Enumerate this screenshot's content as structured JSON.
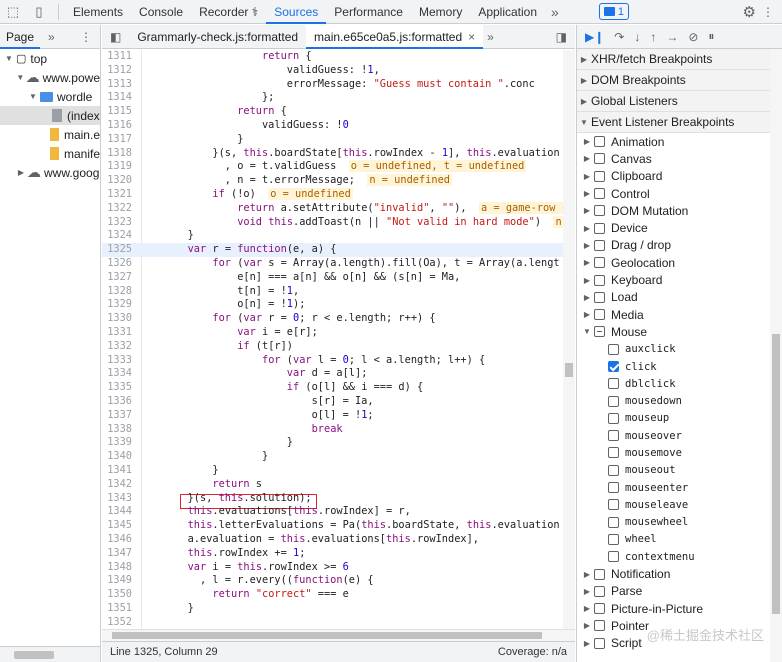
{
  "toolbar": {
    "tabs": [
      "Elements",
      "Console",
      "Recorder ⚕",
      "Sources",
      "Performance",
      "Memory",
      "Application"
    ],
    "active_tab": "Sources",
    "more": "»",
    "badge_count": "1"
  },
  "navigator": {
    "tab": "Page",
    "more": "»",
    "menu": "⋮",
    "tree": [
      {
        "indent": 0,
        "tri": "▼",
        "icon": "frame",
        "label": "top"
      },
      {
        "indent": 1,
        "tri": "▼",
        "icon": "cloud",
        "label": "www.powe"
      },
      {
        "indent": 2,
        "tri": "▼",
        "icon": "folder",
        "label": "wordle"
      },
      {
        "indent": 3,
        "tri": "",
        "icon": "file-gray",
        "label": "(index",
        "selected": true
      },
      {
        "indent": 3,
        "tri": "",
        "icon": "file",
        "label": "main.e"
      },
      {
        "indent": 3,
        "tri": "",
        "icon": "file",
        "label": "manife"
      },
      {
        "indent": 1,
        "tri": "▶",
        "icon": "cloud",
        "label": "www.goog"
      }
    ]
  },
  "editor": {
    "tabs": [
      {
        "label": "Grammarly-check.js:formatted",
        "active": false
      },
      {
        "label": "main.e65ce0a5.js:formatted",
        "active": true
      }
    ],
    "more": "»",
    "highlight_line": 1325,
    "lines": [
      {
        "n": "1311",
        "parts": [
          [
            "ct",
            "                    "
          ],
          [
            "kw",
            "return"
          ],
          [
            "ct",
            " {"
          ]
        ]
      },
      {
        "n": "1312",
        "parts": [
          [
            "ct",
            "                        validGuess: !"
          ],
          [
            "nm",
            "1"
          ],
          [
            "ct",
            ","
          ]
        ]
      },
      {
        "n": "1313",
        "parts": [
          [
            "ct",
            "                        errorMessage: "
          ],
          [
            "st",
            "\"Guess must contain \""
          ],
          [
            "ct",
            ".conc"
          ]
        ]
      },
      {
        "n": "1314",
        "parts": [
          [
            "ct",
            "                    };"
          ]
        ]
      },
      {
        "n": "1315",
        "parts": [
          [
            "ct",
            "                "
          ],
          [
            "kw",
            "return"
          ],
          [
            "ct",
            " {"
          ]
        ]
      },
      {
        "n": "1316",
        "parts": [
          [
            "ct",
            "                    validGuess: !"
          ],
          [
            "nm",
            "0"
          ]
        ]
      },
      {
        "n": "1317",
        "parts": [
          [
            "ct",
            "                }"
          ]
        ]
      },
      {
        "n": "1318",
        "parts": [
          [
            "ct",
            "            }(s, "
          ],
          [
            "kw",
            "this"
          ],
          [
            "ct",
            ".boardState["
          ],
          [
            "kw",
            "this"
          ],
          [
            "ct",
            ".rowIndex - "
          ],
          [
            "nm",
            "1"
          ],
          [
            "ct",
            "], "
          ],
          [
            "kw",
            "this"
          ],
          [
            "ct",
            ".evaluation"
          ]
        ]
      },
      {
        "n": "1319",
        "parts": [
          [
            "ct",
            "              , o = t.validGuess  "
          ],
          [
            "iv",
            "o = undefined, t = undefined"
          ]
        ]
      },
      {
        "n": "1320",
        "parts": [
          [
            "ct",
            "              , n = t.errorMessage;  "
          ],
          [
            "iv",
            "n = undefined"
          ]
        ]
      },
      {
        "n": "1321",
        "parts": [
          [
            "ct",
            "            "
          ],
          [
            "kw",
            "if"
          ],
          [
            "ct",
            " (!o)  "
          ],
          [
            "iv",
            "o = undefined"
          ]
        ]
      },
      {
        "n": "1322",
        "parts": [
          [
            "ct",
            "                "
          ],
          [
            "kw",
            "return"
          ],
          [
            "ct",
            " a.setAttribute("
          ],
          [
            "st",
            "\"invalid\""
          ],
          [
            "ct",
            ", "
          ],
          [
            "st",
            "\"\""
          ],
          [
            "ct",
            "),  "
          ],
          [
            "iv",
            "a = game-row {_"
          ]
        ]
      },
      {
        "n": "1323",
        "parts": [
          [
            "ct",
            "                "
          ],
          [
            "kw",
            "void"
          ],
          [
            "ct",
            " "
          ],
          [
            "kw",
            "this"
          ],
          [
            "ct",
            ".addToast(n || "
          ],
          [
            "st",
            "\"Not valid in hard mode\""
          ],
          [
            "ct",
            ")  "
          ],
          [
            "iv",
            "n ="
          ]
        ]
      },
      {
        "n": "1324",
        "parts": [
          [
            "ct",
            "        }"
          ]
        ]
      },
      {
        "n": "1325",
        "parts": [
          [
            "ct",
            "        "
          ],
          [
            "kw",
            "var"
          ],
          [
            "ct",
            " r = "
          ],
          [
            "kw",
            "function"
          ],
          [
            "ct",
            "(e, a) {"
          ]
        ]
      },
      {
        "n": "1326",
        "parts": [
          [
            "ct",
            "            "
          ],
          [
            "kw",
            "for"
          ],
          [
            "ct",
            " ("
          ],
          [
            "kw",
            "var"
          ],
          [
            "ct",
            " s = Array(a.length).fill(Oa), t = Array(a.lengt"
          ]
        ]
      },
      {
        "n": "1327",
        "parts": [
          [
            "ct",
            "                e[n] === a[n] && o[n] && (s[n] = Ma,"
          ]
        ]
      },
      {
        "n": "1328",
        "parts": [
          [
            "ct",
            "                t[n] = !"
          ],
          [
            "nm",
            "1"
          ],
          [
            "ct",
            ","
          ]
        ]
      },
      {
        "n": "1329",
        "parts": [
          [
            "ct",
            "                o[n] = !"
          ],
          [
            "nm",
            "1"
          ],
          [
            "ct",
            ");"
          ]
        ]
      },
      {
        "n": "1330",
        "parts": [
          [
            "ct",
            "            "
          ],
          [
            "kw",
            "for"
          ],
          [
            "ct",
            " ("
          ],
          [
            "kw",
            "var"
          ],
          [
            "ct",
            " r = "
          ],
          [
            "nm",
            "0"
          ],
          [
            "ct",
            "; r < e.length; r++) {"
          ]
        ]
      },
      {
        "n": "1331",
        "parts": [
          [
            "ct",
            "                "
          ],
          [
            "kw",
            "var"
          ],
          [
            "ct",
            " i = e[r];"
          ]
        ]
      },
      {
        "n": "1332",
        "parts": [
          [
            "ct",
            "                "
          ],
          [
            "kw",
            "if"
          ],
          [
            "ct",
            " (t[r])"
          ]
        ]
      },
      {
        "n": "1333",
        "parts": [
          [
            "ct",
            "                    "
          ],
          [
            "kw",
            "for"
          ],
          [
            "ct",
            " ("
          ],
          [
            "kw",
            "var"
          ],
          [
            "ct",
            " l = "
          ],
          [
            "nm",
            "0"
          ],
          [
            "ct",
            "; l < a.length; l++) {"
          ]
        ]
      },
      {
        "n": "1334",
        "parts": [
          [
            "ct",
            "                        "
          ],
          [
            "kw",
            "var"
          ],
          [
            "ct",
            " d = a[l];"
          ]
        ]
      },
      {
        "n": "1335",
        "parts": [
          [
            "ct",
            "                        "
          ],
          [
            "kw",
            "if"
          ],
          [
            "ct",
            " (o[l] && i === d) {"
          ]
        ]
      },
      {
        "n": "1336",
        "parts": [
          [
            "ct",
            "                            s[r] = Ia,"
          ]
        ]
      },
      {
        "n": "1337",
        "parts": [
          [
            "ct",
            "                            o[l] = !"
          ],
          [
            "nm",
            "1"
          ],
          [
            "ct",
            ";"
          ]
        ]
      },
      {
        "n": "1338",
        "parts": [
          [
            "ct",
            "                            "
          ],
          [
            "kw",
            "break"
          ]
        ]
      },
      {
        "n": "1339",
        "parts": [
          [
            "ct",
            "                        }"
          ]
        ]
      },
      {
        "n": "1340",
        "parts": [
          [
            "ct",
            "                    }"
          ]
        ]
      },
      {
        "n": "1341",
        "parts": [
          [
            "ct",
            "            }"
          ]
        ]
      },
      {
        "n": "1342",
        "parts": [
          [
            "ct",
            "            "
          ],
          [
            "kw",
            "return"
          ],
          [
            "ct",
            " s"
          ]
        ]
      },
      {
        "n": "1343",
        "parts": [
          [
            "ct",
            "        }(s, "
          ],
          [
            "kw",
            "this"
          ],
          [
            "ct",
            ".solution);"
          ]
        ]
      },
      {
        "n": "1344",
        "parts": [
          [
            "ct",
            "        "
          ],
          [
            "kw",
            "this"
          ],
          [
            "ct",
            ".evaluations["
          ],
          [
            "kw",
            "this"
          ],
          [
            "ct",
            ".rowIndex] = r,"
          ]
        ]
      },
      {
        "n": "1345",
        "parts": [
          [
            "ct",
            "        "
          ],
          [
            "kw",
            "this"
          ],
          [
            "ct",
            ".letterEvaluations = Pa("
          ],
          [
            "kw",
            "this"
          ],
          [
            "ct",
            ".boardState, "
          ],
          [
            "kw",
            "this"
          ],
          [
            "ct",
            ".evaluation"
          ]
        ]
      },
      {
        "n": "1346",
        "parts": [
          [
            "ct",
            "        a.evaluation = "
          ],
          [
            "kw",
            "this"
          ],
          [
            "ct",
            ".evaluations["
          ],
          [
            "kw",
            "this"
          ],
          [
            "ct",
            ".rowIndex],"
          ]
        ]
      },
      {
        "n": "1347",
        "parts": [
          [
            "ct",
            "        "
          ],
          [
            "kw",
            "this"
          ],
          [
            "ct",
            ".rowIndex += "
          ],
          [
            "nm",
            "1"
          ],
          [
            "ct",
            ";"
          ]
        ]
      },
      {
        "n": "1348",
        "parts": [
          [
            "ct",
            "        "
          ],
          [
            "kw",
            "var"
          ],
          [
            "ct",
            " i = "
          ],
          [
            "kw",
            "this"
          ],
          [
            "ct",
            ".rowIndex >= "
          ],
          [
            "nm",
            "6"
          ]
        ]
      },
      {
        "n": "1349",
        "parts": [
          [
            "ct",
            "          , l = r.every(("
          ],
          [
            "kw",
            "function"
          ],
          [
            "ct",
            "(e) {"
          ]
        ]
      },
      {
        "n": "1350",
        "parts": [
          [
            "ct",
            "            "
          ],
          [
            "kw",
            "return"
          ],
          [
            "ct",
            " "
          ],
          [
            "st",
            "\"correct\""
          ],
          [
            "ct",
            " === e"
          ]
        ]
      },
      {
        "n": "1351",
        "parts": [
          [
            "ct",
            "        }"
          ]
        ]
      },
      {
        "n": "1352",
        "parts": [
          [
            "ct",
            ""
          ]
        ]
      }
    ],
    "status_position": "Line 1325, Column 29",
    "status_coverage": "Coverage: n/a"
  },
  "debugger": {
    "sections": [
      "XHR/fetch Breakpoints",
      "DOM Breakpoints",
      "Global Listeners",
      "Event Listener Breakpoints"
    ],
    "categories_before": [
      "Animation",
      "Canvas",
      "Clipboard",
      "Control",
      "DOM Mutation",
      "Device",
      "Drag / drop",
      "Geolocation",
      "Keyboard",
      "Load",
      "Media"
    ],
    "mouse_label": "Mouse",
    "mouse_events": [
      {
        "label": "auxclick",
        "checked": false
      },
      {
        "label": "click",
        "checked": true
      },
      {
        "label": "dblclick",
        "checked": false
      },
      {
        "label": "mousedown",
        "checked": false
      },
      {
        "label": "mouseup",
        "checked": false
      },
      {
        "label": "mouseover",
        "checked": false
      },
      {
        "label": "mousemove",
        "checked": false
      },
      {
        "label": "mouseout",
        "checked": false
      },
      {
        "label": "mouseenter",
        "checked": false
      },
      {
        "label": "mouseleave",
        "checked": false
      },
      {
        "label": "mousewheel",
        "checked": false
      },
      {
        "label": "wheel",
        "checked": false
      },
      {
        "label": "contextmenu",
        "checked": false
      }
    ],
    "categories_after": [
      "Notification",
      "Parse",
      "Picture-in-Picture",
      "Pointer",
      "Script"
    ]
  },
  "watermark": "@稀土掘金技术社区"
}
